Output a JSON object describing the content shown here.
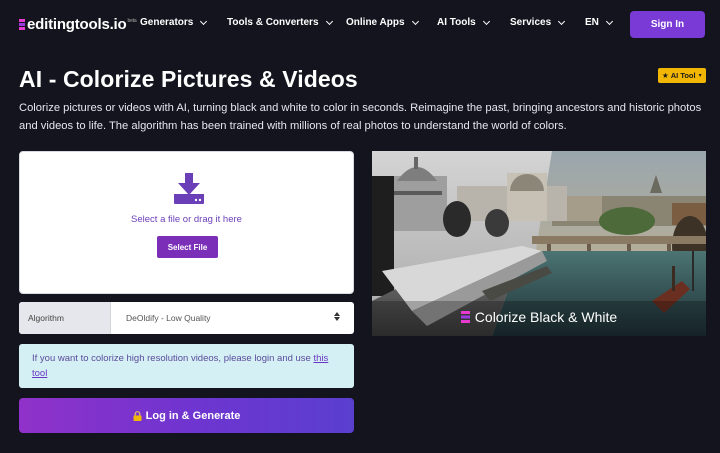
{
  "nav": {
    "logo_text": "editingtools.io",
    "logo_beta": "beta",
    "items": [
      {
        "label": "Generators"
      },
      {
        "label": "Tools & Converters"
      },
      {
        "label": "Online Apps"
      },
      {
        "label": "AI Tools"
      },
      {
        "label": "Services"
      },
      {
        "label": "EN"
      }
    ],
    "signin_label": "Sign In"
  },
  "hero": {
    "title": "AI - Colorize Pictures & Videos",
    "badge": "AI Tool",
    "description": "Colorize pictures or videos with AI, turning black and white to color in seconds. Reimagine the past, bringing ancestors and historic photos and videos to life. The algorithm has been trained with millions of real photos to understand the world of colors."
  },
  "upload": {
    "prompt": "Select a file or drag it here",
    "button": "Select File"
  },
  "algorithm": {
    "label": "Algorithm",
    "selected": "DeOldify - Low Quality"
  },
  "info": {
    "text": "If you want to colorize high resolution videos, please login and use ",
    "link": "this tool"
  },
  "generate": {
    "label": "Log in & Generate"
  },
  "preview": {
    "caption": "Colorize Black & White"
  },
  "colors": {
    "background": "#13141d",
    "accent": "#7a3ad6",
    "badge": "#f2b705",
    "info_bg": "#d4f0f4"
  }
}
